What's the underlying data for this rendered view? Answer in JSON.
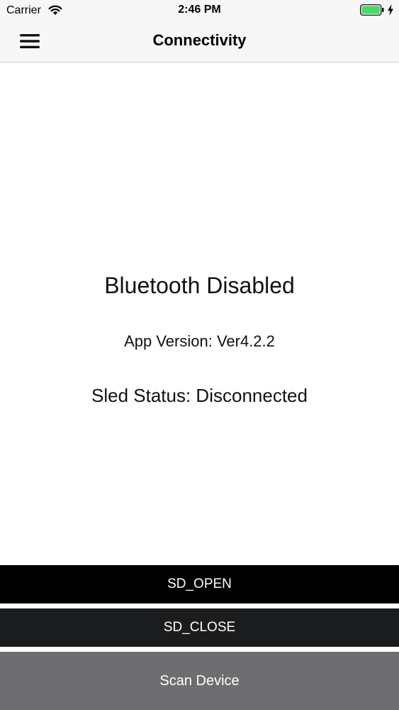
{
  "status_bar": {
    "carrier": "Carrier",
    "time": "2:46 PM"
  },
  "nav": {
    "title": "Connectivity"
  },
  "main": {
    "bluetooth_status": "Bluetooth Disabled",
    "app_version": "App Version: Ver4.2.2",
    "sled_status": "Sled Status: Disconnected"
  },
  "buttons": {
    "sd_open": "SD_OPEN",
    "sd_close": "SD_CLOSE",
    "scan_device": "Scan Device"
  },
  "colors": {
    "bar_background": "#f7f7f7",
    "battery_green": "#4cd964",
    "button_open": "#000000",
    "button_close": "#1b1c1e",
    "button_scan": "#6e6e70"
  }
}
